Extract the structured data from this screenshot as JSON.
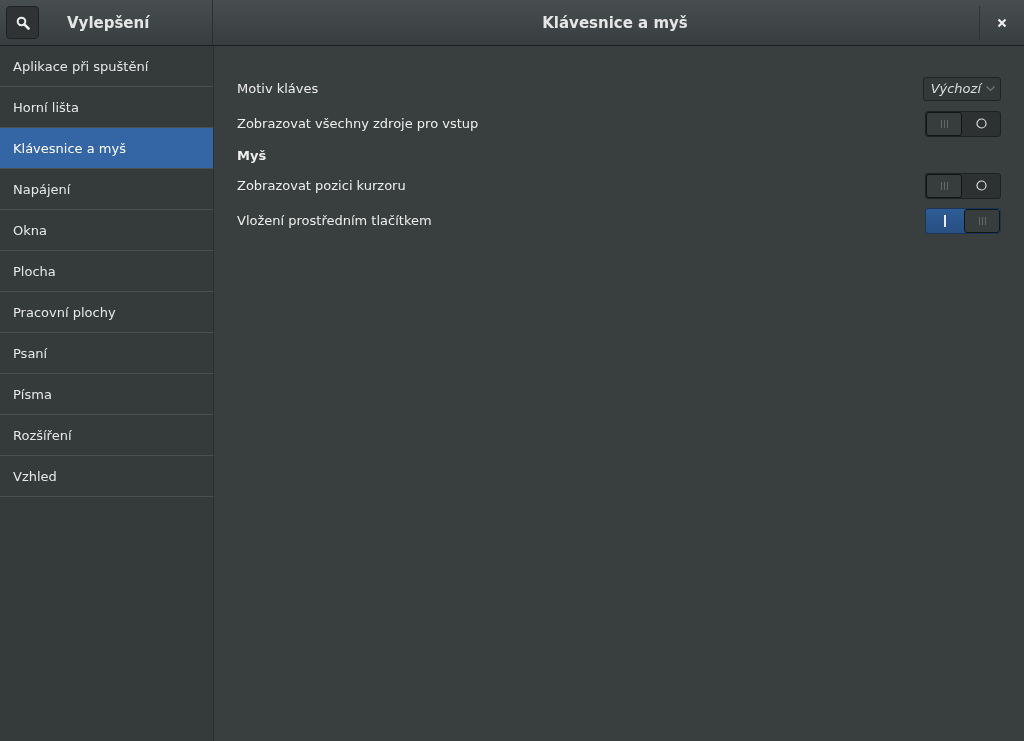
{
  "sidebar": {
    "title": "Vylepšení",
    "items": [
      {
        "label": "Aplikace při spuštění",
        "selected": false
      },
      {
        "label": "Horní lišta",
        "selected": false
      },
      {
        "label": "Klávesnice a myš",
        "selected": true
      },
      {
        "label": "Napájení",
        "selected": false
      },
      {
        "label": "Okna",
        "selected": false
      },
      {
        "label": "Plocha",
        "selected": false
      },
      {
        "label": "Pracovní plochy",
        "selected": false
      },
      {
        "label": "Psaní",
        "selected": false
      },
      {
        "label": "Písma",
        "selected": false
      },
      {
        "label": "Rozšíření",
        "selected": false
      },
      {
        "label": "Vzhled",
        "selected": false
      }
    ]
  },
  "window": {
    "title": "Klávesnice a myš"
  },
  "settings": [
    {
      "kind": "dropdown",
      "label": "Motiv kláves",
      "value": "Výchozí"
    },
    {
      "kind": "switch",
      "label": "Zobrazovat všechny zdroje pro vstup",
      "on": false
    },
    {
      "kind": "heading",
      "label": "Myš"
    },
    {
      "kind": "switch",
      "label": "Zobrazovat pozici kurzoru",
      "on": false
    },
    {
      "kind": "switch",
      "label": "Vložení prostředním tlačítkem",
      "on": true
    }
  ]
}
